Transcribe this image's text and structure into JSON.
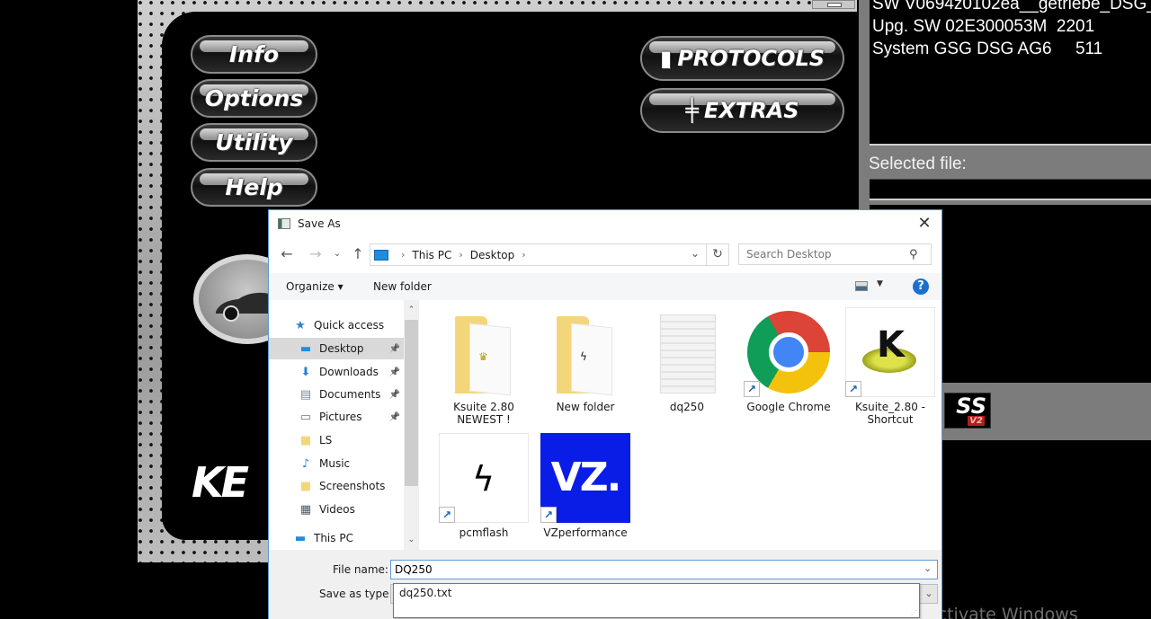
{
  "app": {
    "buttons_left": [
      "Info",
      "Options",
      "Utility",
      "Help"
    ],
    "buttons_right": [
      "PROTOCOLS",
      "EXTRAS"
    ],
    "brand_logo": "KE",
    "info_lines": [
      "SW V0694z0102ea__getriebe_DSG_",
      "Upg. SW 02E300053M  2201",
      "System GSG DSG AG6     511"
    ],
    "selected_file_label": "Selected file:",
    "selected_file_value": "",
    "side_logo": "SS",
    "side_logo_sub": "V2"
  },
  "dialog": {
    "title": "Save As",
    "breadcrumb": [
      "This PC",
      "Desktop"
    ],
    "search_placeholder": "Search Desktop",
    "toolbar": {
      "organize": "Organize ▾",
      "new_folder": "New folder"
    },
    "nav_items": [
      {
        "label": "Quick access",
        "icon": "star-icon",
        "glyph": "★",
        "color": "#2a7fd8",
        "pinned": false,
        "selected": false,
        "indent": 0
      },
      {
        "label": "Desktop",
        "icon": "desktop-icon",
        "glyph": "▬",
        "color": "#1f8ce0",
        "pinned": true,
        "selected": true,
        "indent": 1
      },
      {
        "label": "Downloads",
        "icon": "download-icon",
        "glyph": "⬇",
        "color": "#2a7fd8",
        "pinned": true,
        "selected": false,
        "indent": 1
      },
      {
        "label": "Documents",
        "icon": "documents-icon",
        "glyph": "▤",
        "color": "#7a8a9a",
        "pinned": true,
        "selected": false,
        "indent": 1
      },
      {
        "label": "Pictures",
        "icon": "pictures-icon",
        "glyph": "▭",
        "color": "#5a7a9a",
        "pinned": true,
        "selected": false,
        "indent": 1
      },
      {
        "label": "LS",
        "icon": "folder-icon",
        "glyph": "■",
        "color": "#f4d67a",
        "pinned": false,
        "selected": false,
        "indent": 1
      },
      {
        "label": "Music",
        "icon": "music-icon",
        "glyph": "♪",
        "color": "#2a7fd8",
        "pinned": false,
        "selected": false,
        "indent": 1
      },
      {
        "label": "Screenshots",
        "icon": "folder-icon",
        "glyph": "■",
        "color": "#f4d67a",
        "pinned": false,
        "selected": false,
        "indent": 1
      },
      {
        "label": "Videos",
        "icon": "videos-icon",
        "glyph": "▦",
        "color": "#4a5a6a",
        "pinned": false,
        "selected": false,
        "indent": 1
      },
      {
        "label": "This PC",
        "icon": "this-pc-icon",
        "glyph": "▬",
        "color": "#1f8ce0",
        "pinned": false,
        "selected": false,
        "indent": 0
      }
    ],
    "files": [
      {
        "name": "Ksuite 2.80 NEWEST !",
        "type": "folder",
        "shortcut": false
      },
      {
        "name": "New folder",
        "type": "folder",
        "shortcut": false
      },
      {
        "name": "dq250",
        "type": "text-file",
        "shortcut": false
      },
      {
        "name": "Google Chrome",
        "type": "chrome",
        "shortcut": true
      },
      {
        "name": "Ksuite_2.80 - Shortcut",
        "type": "ksuite",
        "shortcut": true
      },
      {
        "name": "pcmflash",
        "type": "pcmflash",
        "shortcut": true
      },
      {
        "name": "VZperformance",
        "type": "vz",
        "shortcut": true
      }
    ],
    "file_name_label": "File name:",
    "file_name_value": "DQ250",
    "save_as_type_label": "Save as type:",
    "autocomplete_suggestion": "dq250.txt"
  },
  "watermark": "Activate Windows"
}
